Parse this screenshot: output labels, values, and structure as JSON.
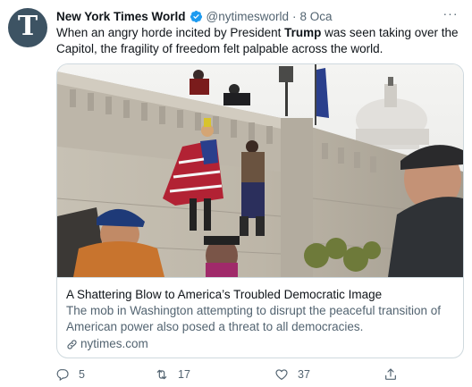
{
  "tweet": {
    "avatar_glyph": "T",
    "author_name": "New York Times World",
    "handle": "@nytimesworld",
    "separator": "·",
    "date": "8 Oca",
    "more_glyph": "···",
    "text_before": "When an angry horde incited by President ",
    "text_bold": "Trump",
    "text_after": " was seen taking over the Capitol, the fragility of freedom felt palpable across the world."
  },
  "card": {
    "title": "A Shattering Blow to America’s Troubled Democratic Image",
    "description": "The mob in Washington attempting to disrupt the peaceful transition of American power also posed a threat to all democracies.",
    "domain": "nytimes.com"
  },
  "actions": {
    "reply_count": "5",
    "retweet_count": "17",
    "like_count": "37"
  },
  "colors": {
    "verified_blue": "#1d9bf0",
    "secondary_text": "#536471",
    "border": "#cfd9de",
    "avatar_bg": "#3d5363"
  },
  "icons": {
    "verified": "verified-badge-icon",
    "more": "more-options-icon",
    "link": "link-icon",
    "reply": "reply-icon",
    "retweet": "retweet-icon",
    "like": "heart-icon",
    "share": "share-icon"
  }
}
